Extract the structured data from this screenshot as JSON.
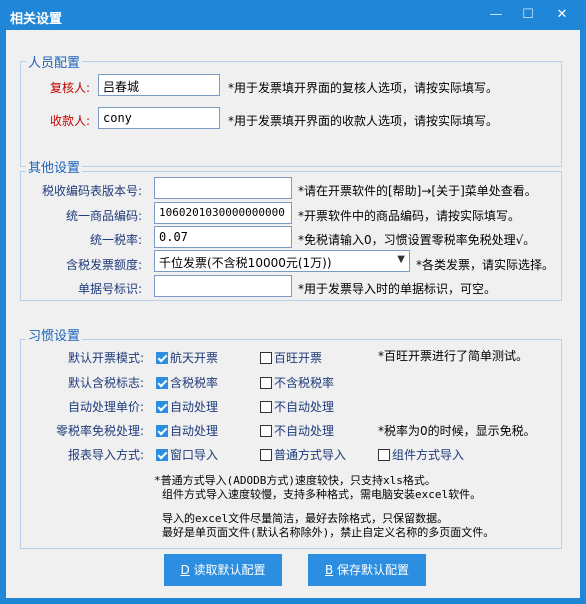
{
  "window": {
    "title": "相关设置",
    "minimize": "—",
    "maximize": "☐",
    "close": "✕"
  },
  "personnel": {
    "legend": "人员配置",
    "reviewer_label": "复核人:",
    "reviewer_value": "吕春城",
    "reviewer_note": "*用于发票填开界面的复核人选项，请按实际填写。",
    "payee_label": "收款人:",
    "payee_value": "cony",
    "payee_note": "*用于发票填开界面的收款人选项，请按实际填写。"
  },
  "other": {
    "legend": "其他设置",
    "taxcode_label": "税收编码表版本号:",
    "taxcode_value": "",
    "taxcode_note": "*请在开票软件的[帮助]→[关于]菜单处查看。",
    "goodscode_label": "统一商品编码:",
    "goodscode_value": "1060201030000000000",
    "goodscode_note": "*开票软件中的商品编码，请按实际填写。",
    "taxrate_label": "统一税率:",
    "taxrate_value": "0.07",
    "taxrate_note": "*免税请输入0，习惯设置零税率免税处理√。",
    "limit_label": "含税发票额度:",
    "limit_value": "千位发票(不含税10000元(1万))",
    "limit_note": "*各类发票，请实际选择。",
    "docno_label": "单据号标识:",
    "docno_value": "",
    "docno_note": "*用于发票导入时的单据标识，可空。"
  },
  "habits": {
    "legend": "习惯设置",
    "rows": [
      {
        "label": "默认开票模式:",
        "opt1": "航天开票",
        "opt1_on": true,
        "opt2": "百旺开票",
        "opt2_on": false,
        "note": "*百旺开票进行了简单测试。"
      },
      {
        "label": "默认含税标志:",
        "opt1": "含税税率",
        "opt1_on": true,
        "opt2": "不含税税率",
        "opt2_on": false
      },
      {
        "label": "自动处理单价:",
        "opt1": "自动处理",
        "opt1_on": true,
        "opt2": "不自动处理",
        "opt2_on": false
      },
      {
        "label": "零税率免税处理:",
        "opt1": "自动处理",
        "opt1_on": true,
        "opt2": "不自动处理",
        "opt2_on": false,
        "note": "*税率为0的时候，显示免税。"
      },
      {
        "label": "报表导入方式:",
        "opt1": "窗口导入",
        "opt1_on": true,
        "opt2": "普通方式导入",
        "opt2_on": false,
        "opt3": "组件方式导入",
        "opt3_on": false
      }
    ],
    "info1": "*普通方式导入(ADODB方式)速度较快，只支持xls格式。",
    "info2": "组件方式导入速度较慢，支持多种格式，需电脑安装excel软件。",
    "info3": "导入的excel文件尽量简洁，最好去除格式，只保留数据。",
    "info4": "最好是单页面文件(默认名称除外)，禁止自定义名称的多页面文件。"
  },
  "buttons": {
    "read_key": "D",
    "read_label": " 读取默认配置",
    "save_key": "B",
    "save_label": " 保存默认配置"
  }
}
